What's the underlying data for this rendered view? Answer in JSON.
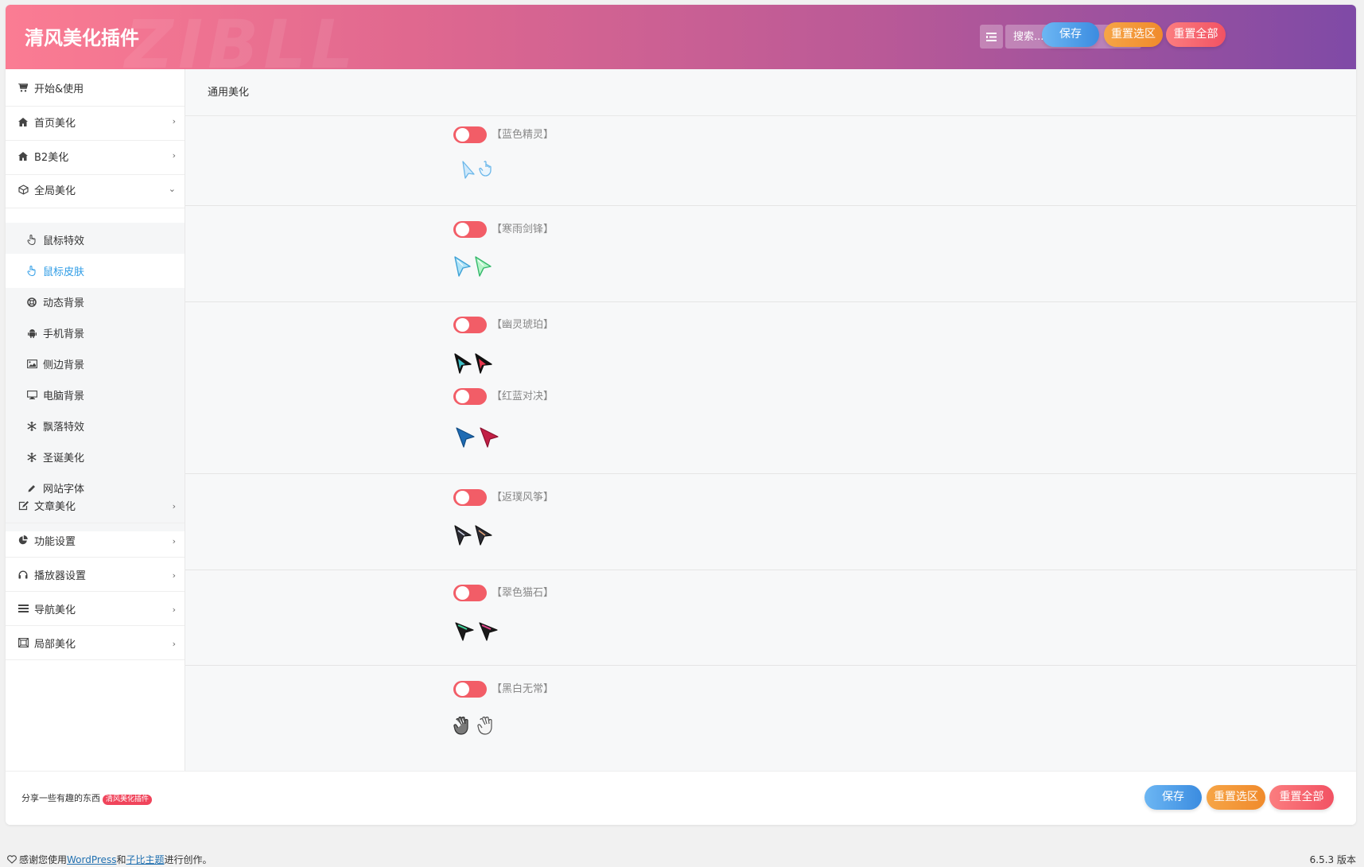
{
  "header": {
    "title": "清风美化插件",
    "watermark": "ZIBLL",
    "search_placeholder": "搜索...",
    "save_label": "保存",
    "reset_section_label": "重置选区",
    "reset_all_label": "重置全部"
  },
  "sidebar": {
    "items": [
      {
        "label": "开始&使用",
        "icon": "cart-icon"
      },
      {
        "label": "首页美化",
        "icon": "home-icon"
      },
      {
        "label": "B2美化",
        "icon": "home-icon"
      },
      {
        "label": "全局美化",
        "icon": "cube-icon"
      },
      {
        "label": "文章美化",
        "icon": "edit-icon"
      },
      {
        "label": "功能设置",
        "icon": "pie-chart-icon"
      },
      {
        "label": "播放器设置",
        "icon": "headphones-icon"
      },
      {
        "label": "导航美化",
        "icon": "navicon-icon"
      },
      {
        "label": "局部美化",
        "icon": "crop-icon"
      }
    ],
    "subitems": [
      {
        "label": "鼠标特效",
        "icon": "hand-pointer-icon"
      },
      {
        "label": "鼠标皮肤",
        "icon": "hand-pointer-icon"
      },
      {
        "label": "动态背景",
        "icon": "life-ring-icon"
      },
      {
        "label": "手机背景",
        "icon": "android-icon"
      },
      {
        "label": "侧边背景",
        "icon": "image-icon"
      },
      {
        "label": "电脑背景",
        "icon": "desktop-icon"
      },
      {
        "label": "飘落特效",
        "icon": "snowflake-icon"
      },
      {
        "label": "圣诞美化",
        "icon": "snowflake-icon"
      },
      {
        "label": "网站字体",
        "icon": "pencil-icon"
      }
    ],
    "active_subitem": "鼠标皮肤"
  },
  "content": {
    "section_title": "通用美化",
    "options": [
      {
        "label": "【蓝色精灵】",
        "enabled": false
      },
      {
        "label": "【寒雨剑锋】",
        "enabled": false
      },
      {
        "label": "【幽灵琥珀】",
        "enabled": false
      },
      {
        "label": "【红蓝对决】",
        "enabled": false
      },
      {
        "label": "【返璞风筝】",
        "enabled": false
      },
      {
        "label": "【翠色猫石】",
        "enabled": false
      },
      {
        "label": "【黑白无常】",
        "enabled": false
      }
    ]
  },
  "footer": {
    "share_text": "分享一些有趣的东西",
    "tag": "清风美化插件",
    "save_label": "保存",
    "reset_section_label": "重置选区",
    "reset_all_label": "重置全部"
  },
  "wp_footer": {
    "heart_icon": "heart-icon",
    "text_1": "感谢您使用",
    "link_wordpress": "WordPress",
    "text_2": "和",
    "link_theme": "子比主题",
    "text_3": "进行创作。",
    "version": "6.5.3 版本"
  },
  "colors": {
    "header_gradient_start": "#fb7c93",
    "header_gradient_end": "#7f4aa6",
    "toggle_off": "#f25d67",
    "active_link": "#2e9ce6",
    "btn_blue": "#3b8ce0",
    "btn_orange": "#f08a2c",
    "btn_red": "#f25263"
  }
}
